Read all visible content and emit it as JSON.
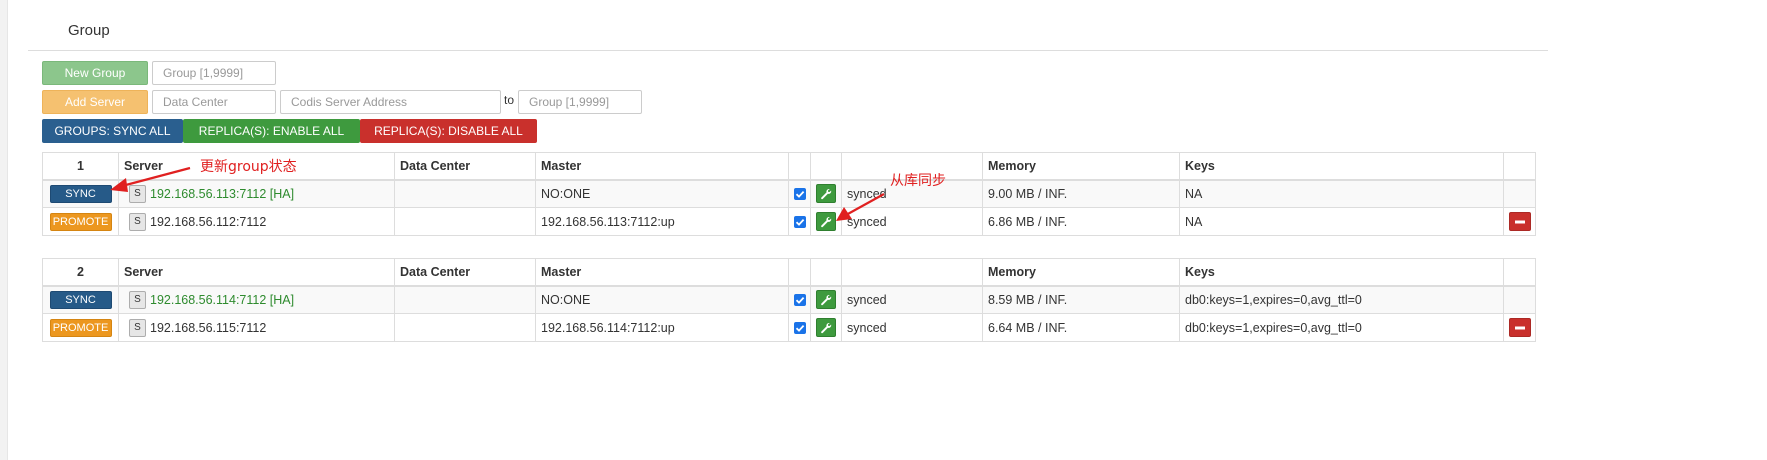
{
  "panel": {
    "title": "Group"
  },
  "toolbar": {
    "new_group_label": "New Group",
    "group_id_placeholder": "Group [1,9999]",
    "add_server_label": "Add Server",
    "data_center_placeholder": "Data Center",
    "server_address_placeholder": "Codis Server Address",
    "to_label": "to",
    "target_group_placeholder": "Group [1,9999]",
    "sync_all_label": "GROUPS: SYNC ALL",
    "replica_enable_label": "REPLICA(S): ENABLE ALL",
    "replica_disable_label": "REPLICA(S): DISABLE ALL"
  },
  "columns": {
    "server": "Server",
    "data_center": "Data Center",
    "master": "Master",
    "memory": "Memory",
    "keys": "Keys"
  },
  "groups": [
    {
      "id": "1",
      "rows": [
        {
          "action": "SYNC",
          "s": "S",
          "server": "192.168.56.113:7112 [HA]",
          "data_center": "",
          "master": "NO:ONE",
          "status": "synced",
          "memory": "9.00 MB / INF.",
          "keys": "NA"
        },
        {
          "action": "PROMOTE",
          "s": "S",
          "server": "192.168.56.112:7112",
          "data_center": "",
          "master": "192.168.56.113:7112:up",
          "status": "synced",
          "memory": "6.86 MB / INF.",
          "keys": "NA"
        }
      ]
    },
    {
      "id": "2",
      "rows": [
        {
          "action": "SYNC",
          "s": "S",
          "server": "192.168.56.114:7112 [HA]",
          "data_center": "",
          "master": "NO:ONE",
          "status": "synced",
          "memory": "8.59 MB / INF.",
          "keys": "db0:keys=1,expires=0,avg_ttl=0"
        },
        {
          "action": "PROMOTE",
          "s": "S",
          "server": "192.168.56.115:7112",
          "data_center": "",
          "master": "192.168.56.114:7112:up",
          "status": "synced",
          "memory": "6.64 MB / INF.",
          "keys": "db0:keys=1,expires=0,avg_ttl=0"
        }
      ]
    }
  ],
  "annotations": {
    "sync_note": "更新group状态",
    "replica_note": "从库同步"
  },
  "colors": {
    "new_group": "#8cc68c",
    "add_server": "#f5c170",
    "sync_all": "#2a5f8f",
    "replica_enable": "#3e9a3e",
    "replica_disable": "#c9302c",
    "annotation": "#e02020"
  }
}
